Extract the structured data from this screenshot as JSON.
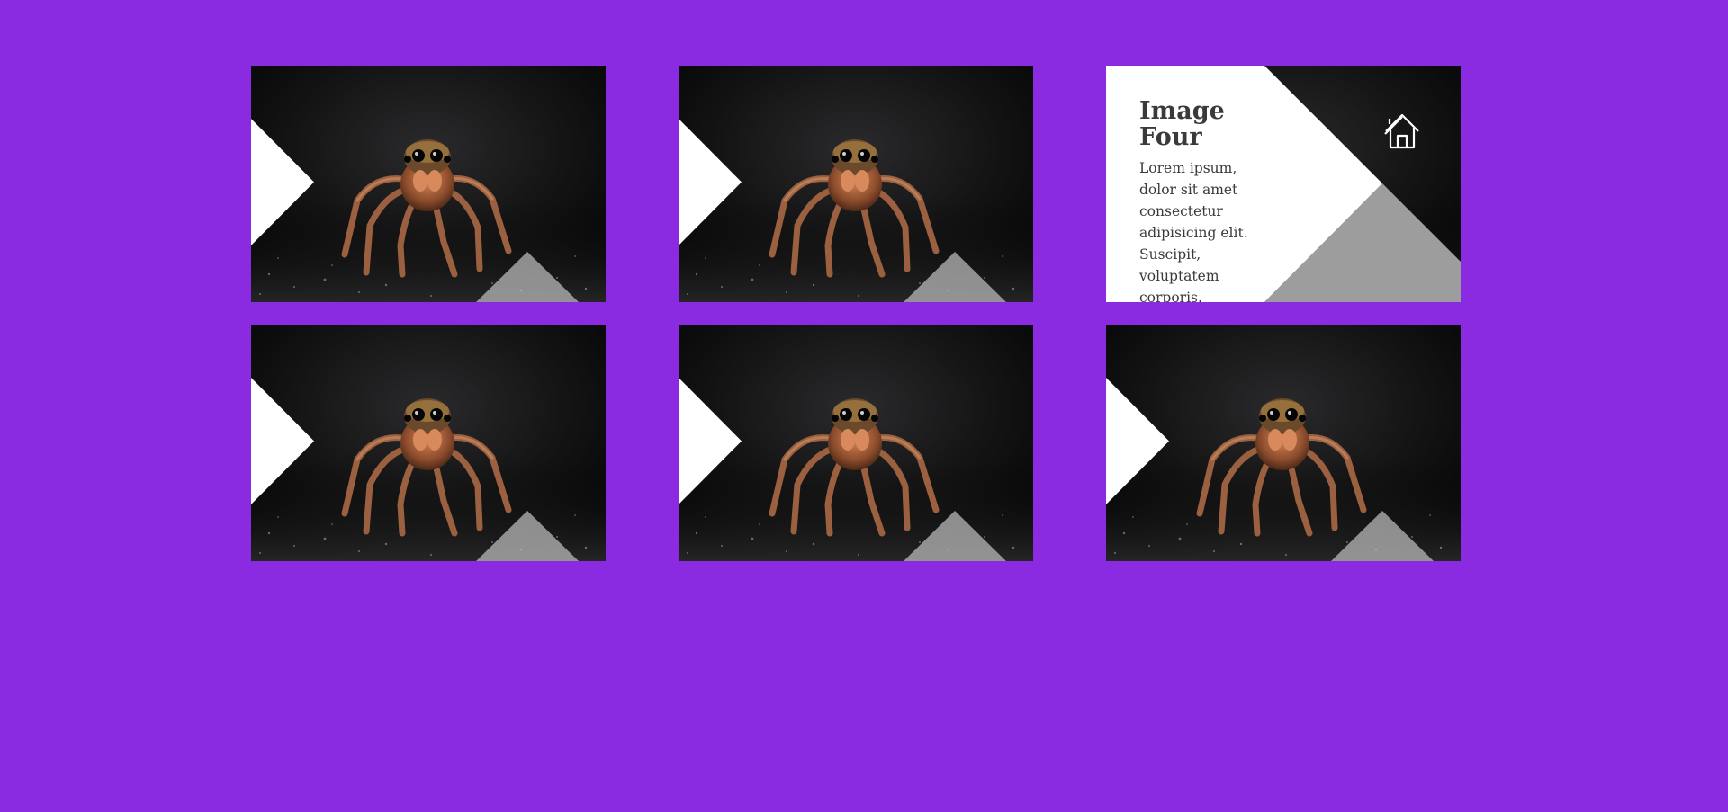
{
  "page": {
    "background": "#8a2be2"
  },
  "cards": [
    {
      "title": "",
      "body": "",
      "state": "default"
    },
    {
      "title": "",
      "body": "",
      "state": "default"
    },
    {
      "title": "Image Four",
      "body": "Lorem ipsum, dolor sit amet consectetur adipisicing elit. Suscipit, voluptatem corporis.",
      "state": "hover",
      "icon": "home-icon"
    },
    {
      "title": "",
      "body": "",
      "state": "default"
    },
    {
      "title": "",
      "body": "",
      "state": "default"
    },
    {
      "title": "",
      "body": "",
      "state": "default"
    }
  ],
  "colors": {
    "accent_white": "#ffffff",
    "accent_grey": "#9d9d9d",
    "text": "#3a3a3a"
  }
}
